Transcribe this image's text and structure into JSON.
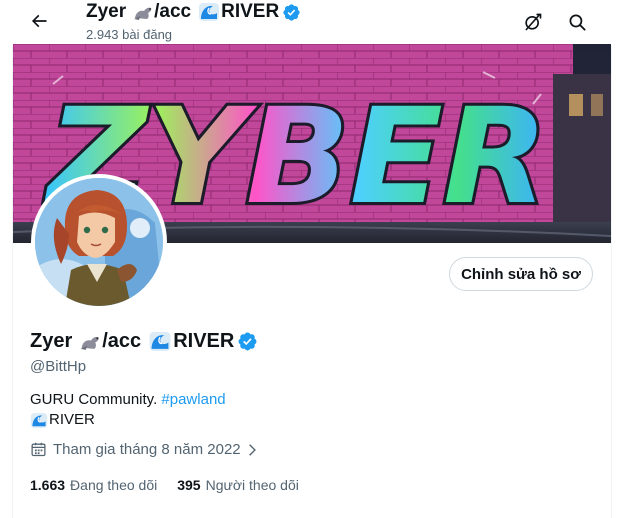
{
  "header": {
    "name_prefix": "Zyer",
    "name_middle": "/acc",
    "name_suffix": "RIVER",
    "post_count": "2.943 bài đăng"
  },
  "profile": {
    "name_prefix": "Zyer",
    "name_middle": "/acc",
    "name_suffix": "RIVER",
    "handle": "@BittHp",
    "edit_button": "Chỉnh sửa hồ sơ",
    "bio_text": "GURU Community. ",
    "bio_hashtag": "#pawland",
    "bio_line2": "RIVER",
    "joined": "Tham gia tháng 8 năm 2022",
    "following_count": "1.663",
    "following_label": "Đang theo dõi",
    "followers_count": "395",
    "followers_label": "Người theo dõi"
  },
  "banner": {
    "graffiti_text": "ZYBER"
  },
  "colors": {
    "accent": "#1d9bf0",
    "verified": "#1d9bf0",
    "muted": "#536471",
    "text": "#0f1419"
  },
  "icons": [
    "back-arrow-icon",
    "seal-emoji-icon",
    "wave-emoji-icon",
    "verified-badge-icon",
    "grok-icon",
    "search-icon",
    "calendar-icon",
    "chevron-right-icon"
  ]
}
